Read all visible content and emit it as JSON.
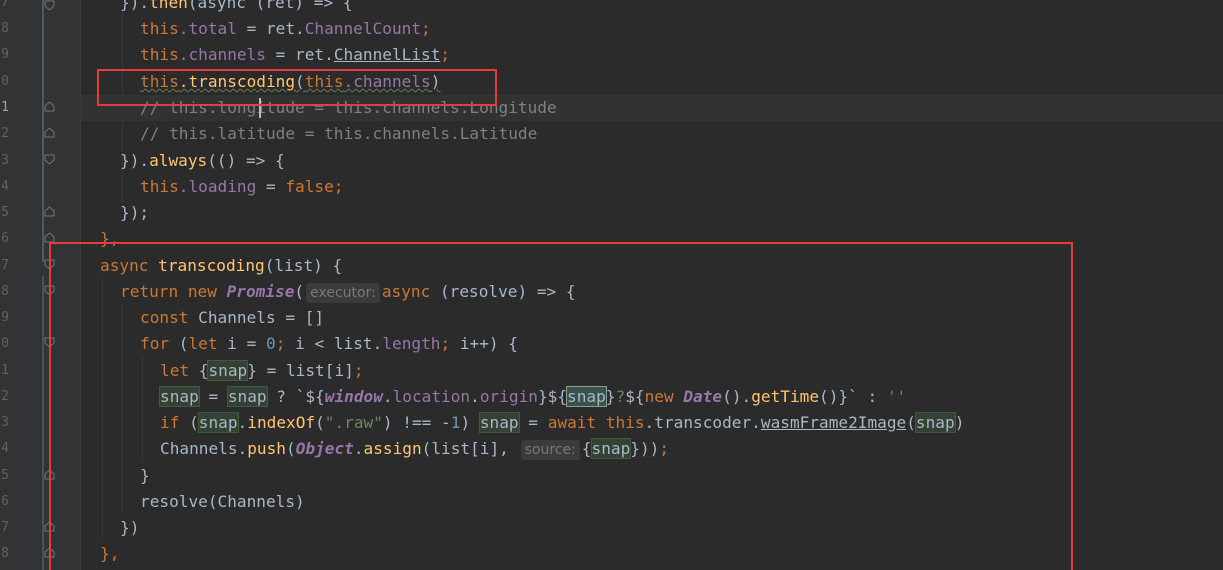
{
  "gutter": {
    "line_numbers": [
      "7",
      "8",
      "9",
      "0",
      "1",
      "2",
      "3",
      "4",
      "5",
      "6",
      "7",
      "8",
      "9",
      "0",
      "1",
      "2",
      "3",
      "4",
      "5",
      "6",
      "7",
      "8"
    ]
  },
  "code": {
    "l0_a": "}).",
    "l0_then": "then",
    "l0_b": "(async (ret) => {",
    "l1_this": "this",
    "l1_total": ".total",
    "l1_eq": " = ret.",
    "l1_cc": "ChannelCount",
    "l1_semi": ";",
    "l2_this": "this",
    "l2_channels": ".channels",
    "l2_eq": " = ret.",
    "l2_cl": "ChannelList",
    "l2_semi": ";",
    "l3_this": "this",
    "l3_trans": ".transcoding",
    "l3_open": "(",
    "l3_this2": "this",
    "l3_channels": ".channels",
    "l3_close": ")",
    "l4_comment": "// this.longitude = this.channels.Longitude",
    "l5_comment": "// this.latitude = this.channels.Latitude",
    "l6_a": "}).",
    "l6_always": "always",
    "l6_b": "(() => {",
    "l7_this": "this",
    "l7_loading": ".loading",
    "l7_eq": " = ",
    "l7_false": "false;",
    "l8_a": "});",
    "l9_a": "},",
    "l10_async": "async ",
    "l10_fn": "transcoding",
    "l10_b": "(list) {",
    "l11_return": "return new ",
    "l11_promise": "Promise",
    "l11_paren": "(",
    "l11_hint": "executor:",
    "l11_async": "async ",
    "l11_b": "(resolve) => {",
    "l12_const": "const ",
    "l12_b": "Channels = []",
    "l13_for": "for ",
    "l13_open": "(",
    "l13_let": "let ",
    "l13_i": "i = ",
    "l13_zero": "0",
    "l13_semi": "; ",
    "l13_cmp": "i < list.",
    "l13_length": "length",
    "l13_semi2": "; ",
    "l13_end": "i++) {",
    "l14_let": "let ",
    "l14_brace": "{",
    "l14_snap": "snap",
    "l14_b": "} = list[i]",
    "l14_semi": ";",
    "l15_snap1": "snap",
    "l15_eq": " = ",
    "l15_snap2": "snap",
    "l15_q": " ? `${",
    "l15_window": "window",
    "l15_dot1": ".",
    "l15_location": "location",
    "l15_dot2": ".",
    "l15_origin": "origin",
    "l15_mid": "}${",
    "l15_snap3": "snap",
    "l15_close": "}",
    "l15_qs": "?",
    "l15_dollar": "${",
    "l15_new": "new ",
    "l15_date": "Date",
    "l15_call": "().",
    "l15_gettime": "getTime",
    "l15_end": "()}` : ",
    "l15_empty": "''",
    "l16_if": "if ",
    "l16_open": "(",
    "l16_snap": "snap",
    "l16_dot": ".",
    "l16_indexof": "indexOf",
    "l16_p": "(",
    "l16_raw": "\".raw\"",
    "l16_ne": ") !== -",
    "l16_one": "1",
    "l16_cp": ") ",
    "l16_snap2": "snap",
    "l16_eq": " = ",
    "l16_await": "await ",
    "l16_this": "this",
    "l16_tc": ".transcoder.",
    "l16_wasm": "wasmFrame2Image",
    "l16_p2": "(",
    "l16_snap3": "snap",
    "l16_cp2": ")",
    "l17_a": "Channels.",
    "l17_push": "push",
    "l17_p": "(",
    "l17_object": "Object",
    "l17_dot": ".",
    "l17_assign": "assign",
    "l17_b": "(list[i], ",
    "l17_hint": "source:",
    "l17_brace": "{",
    "l17_snap": "snap",
    "l17_end": "}))",
    "l17_semi": ";",
    "l18_a": "}",
    "l19_a": "resolve(Channels)",
    "l20_a": "})",
    "l21_a": "},"
  },
  "colors": {
    "background": "#2b2b2b",
    "keyword": "#cc7832",
    "property": "#9876aa",
    "string": "#6a8759",
    "function": "#ffc66d",
    "annotation_box": "#e83b3b"
  }
}
